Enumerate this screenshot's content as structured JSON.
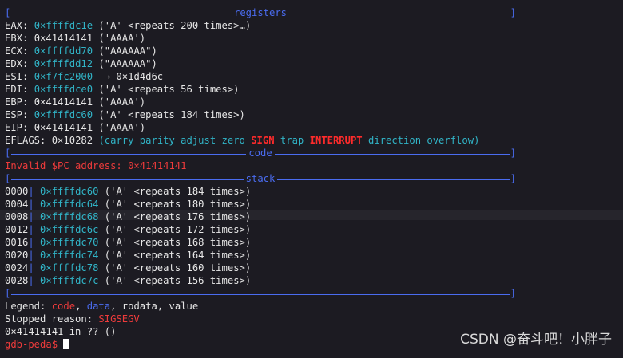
{
  "registers_title": "registers",
  "code_title": "code",
  "stack_title": "stack",
  "registers": [
    {
      "name": "EAX:",
      "addr": "0×ffffdc1e",
      "desc": "('A' <repeats 200 times>…)",
      "style": "cyan"
    },
    {
      "name": "EBX:",
      "addr": "0×41414141",
      "desc": "('AAAA')",
      "style": "white"
    },
    {
      "name": "ECX:",
      "addr": "0×ffffdd70",
      "desc": "(\"AAAAAA\")",
      "style": "cyan"
    },
    {
      "name": "EDX:",
      "addr": "0×ffffdd12",
      "desc": "(\"AAAAAA\")",
      "style": "cyan"
    },
    {
      "name": "ESI:",
      "addr": "0×f7fc2000",
      "desc": "—→ 0×1d4d6c",
      "style": "cyan"
    },
    {
      "name": "EDI:",
      "addr": "0×ffffdce0",
      "desc": "('A' <repeats 56 times>)",
      "style": "cyan"
    },
    {
      "name": "EBP:",
      "addr": "0×41414141",
      "desc": "('AAAA')",
      "style": "white"
    },
    {
      "name": "ESP:",
      "addr": "0×ffffdc60",
      "desc": "('A' <repeats 184 times>)",
      "style": "cyan"
    },
    {
      "name": "EIP:",
      "addr": "0×41414141",
      "desc": "('AAAA')",
      "style": "white"
    }
  ],
  "eflags": {
    "name": "EFLAGS:",
    "value": "0×10282",
    "open": "(",
    "flags_pre": "carry parity adjust zero ",
    "flag_sign": "SIGN",
    "flag_trap": " trap ",
    "flag_interrupt": "INTERRUPT",
    "flags_post": " direction overflow",
    "close": ")"
  },
  "invalid_pc": "Invalid $PC address: 0×41414141",
  "stack": [
    {
      "offset": "0000",
      "addr": "0×ffffdc60",
      "desc": "('A' <repeats 184 times>)"
    },
    {
      "offset": "0004",
      "addr": "0×ffffdc64",
      "desc": "('A' <repeats 180 times>)"
    },
    {
      "offset": "0008",
      "addr": "0×ffffdc68",
      "desc": "('A' <repeats 176 times>)"
    },
    {
      "offset": "0012",
      "addr": "0×ffffdc6c",
      "desc": "('A' <repeats 172 times>)"
    },
    {
      "offset": "0016",
      "addr": "0×ffffdc70",
      "desc": "('A' <repeats 168 times>)"
    },
    {
      "offset": "0020",
      "addr": "0×ffffdc74",
      "desc": "('A' <repeats 164 times>)"
    },
    {
      "offset": "0024",
      "addr": "0×ffffdc78",
      "desc": "('A' <repeats 160 times>)"
    },
    {
      "offset": "0028",
      "addr": "0×ffffdc7c",
      "desc": "('A' <repeats 156 times>)"
    }
  ],
  "legend": {
    "label": "Legend: ",
    "code": "code",
    "sep1": ", ",
    "data": "data",
    "sep2": ", ",
    "rodata": "rodata",
    "sep3": ", ",
    "value": "value"
  },
  "stopped": {
    "label": "Stopped reason: ",
    "reason": "SIGSEGV"
  },
  "location": "0×41414141 in ?? ()",
  "prompt": "gdb-peda$ ",
  "watermark": "CSDN @奋斗吧！小胖子",
  "colors": {
    "accent_blue": "#4a6cf0",
    "cyan": "#31b4c7",
    "red": "#ee3b3b",
    "background": "#1c1b22"
  }
}
